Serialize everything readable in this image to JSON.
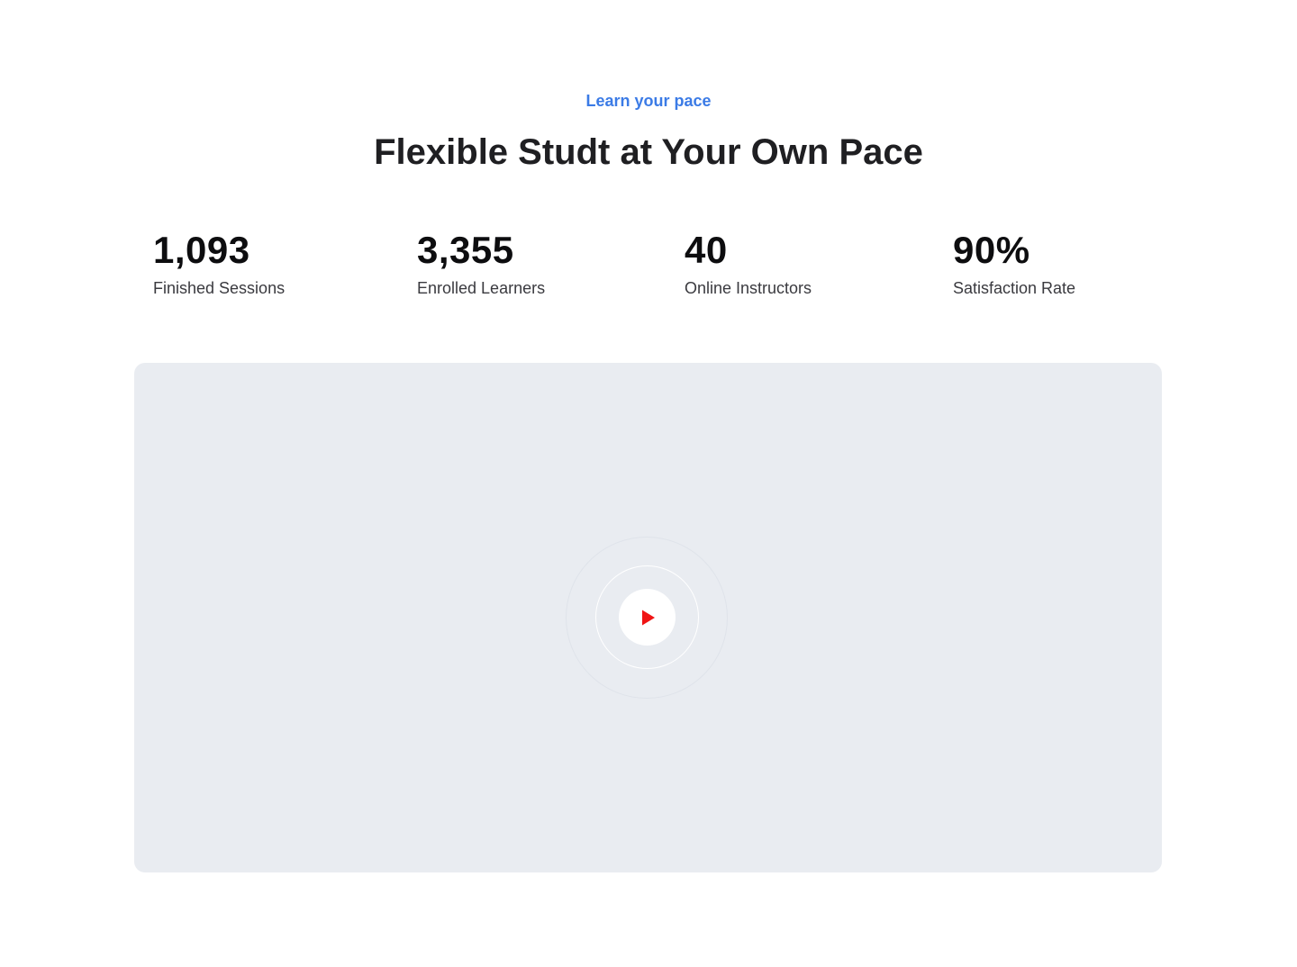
{
  "section": {
    "eyebrow": "Learn your pace",
    "title": "Flexible Studt at Your Own Pace"
  },
  "stats": [
    {
      "value": "1,093",
      "label": "Finished Sessions"
    },
    {
      "value": "3,355",
      "label": "Enrolled Learners"
    },
    {
      "value": "40",
      "label": "Online Instructors"
    },
    {
      "value": "90%",
      "label": "Satisfaction Rate"
    }
  ],
  "video": {
    "play_icon": "play-icon",
    "play_color": "#f01414",
    "panel_color": "#e9ecf1"
  },
  "colors": {
    "accent": "#3b7be6",
    "heading": "#1f1f22"
  }
}
